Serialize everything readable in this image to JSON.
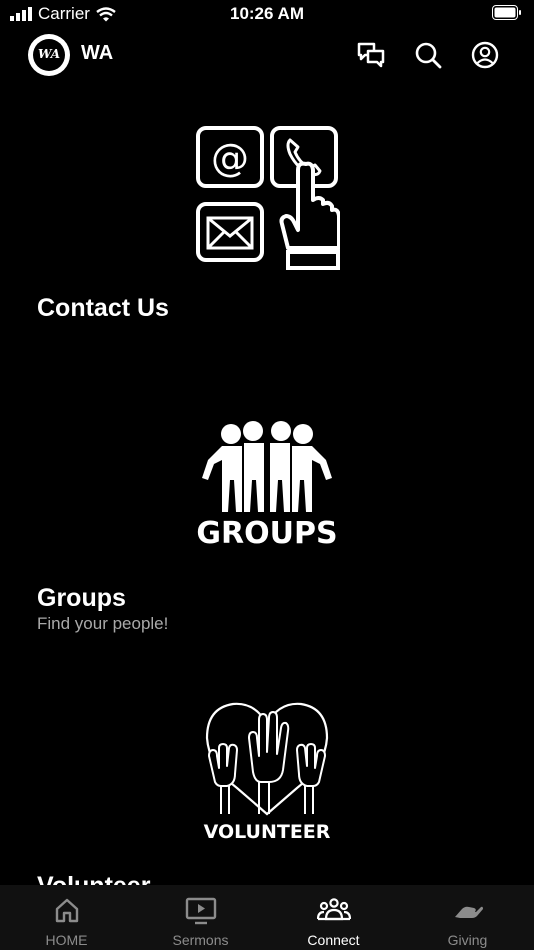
{
  "status_bar": {
    "carrier": "Carrier",
    "time": "10:26 AM"
  },
  "header": {
    "logo_text": "WA",
    "title": "WA"
  },
  "cards": [
    {
      "title": "Contact Us",
      "subtitle": "",
      "graphic": "contact-icons"
    },
    {
      "title": "Groups",
      "subtitle": "Find your people!",
      "graphic": "groups-icon",
      "graphic_text": "GROUPS"
    },
    {
      "title": "Volunteer",
      "subtitle": "",
      "graphic": "volunteer-icon",
      "graphic_text": "VOLUNTEER"
    }
  ],
  "tabs": [
    {
      "label": "HOME",
      "icon": "home-icon",
      "active": false
    },
    {
      "label": "Sermons",
      "icon": "tv-play-icon",
      "active": false
    },
    {
      "label": "Connect",
      "icon": "people-icon",
      "active": true
    },
    {
      "label": "Giving",
      "icon": "giving-hand-icon",
      "active": false
    }
  ],
  "colors": {
    "background": "#000000",
    "text": "#ffffff",
    "subtitle": "#a9a9a9",
    "tab_inactive": "#8c8c8c",
    "tab_bar": "#111111"
  }
}
